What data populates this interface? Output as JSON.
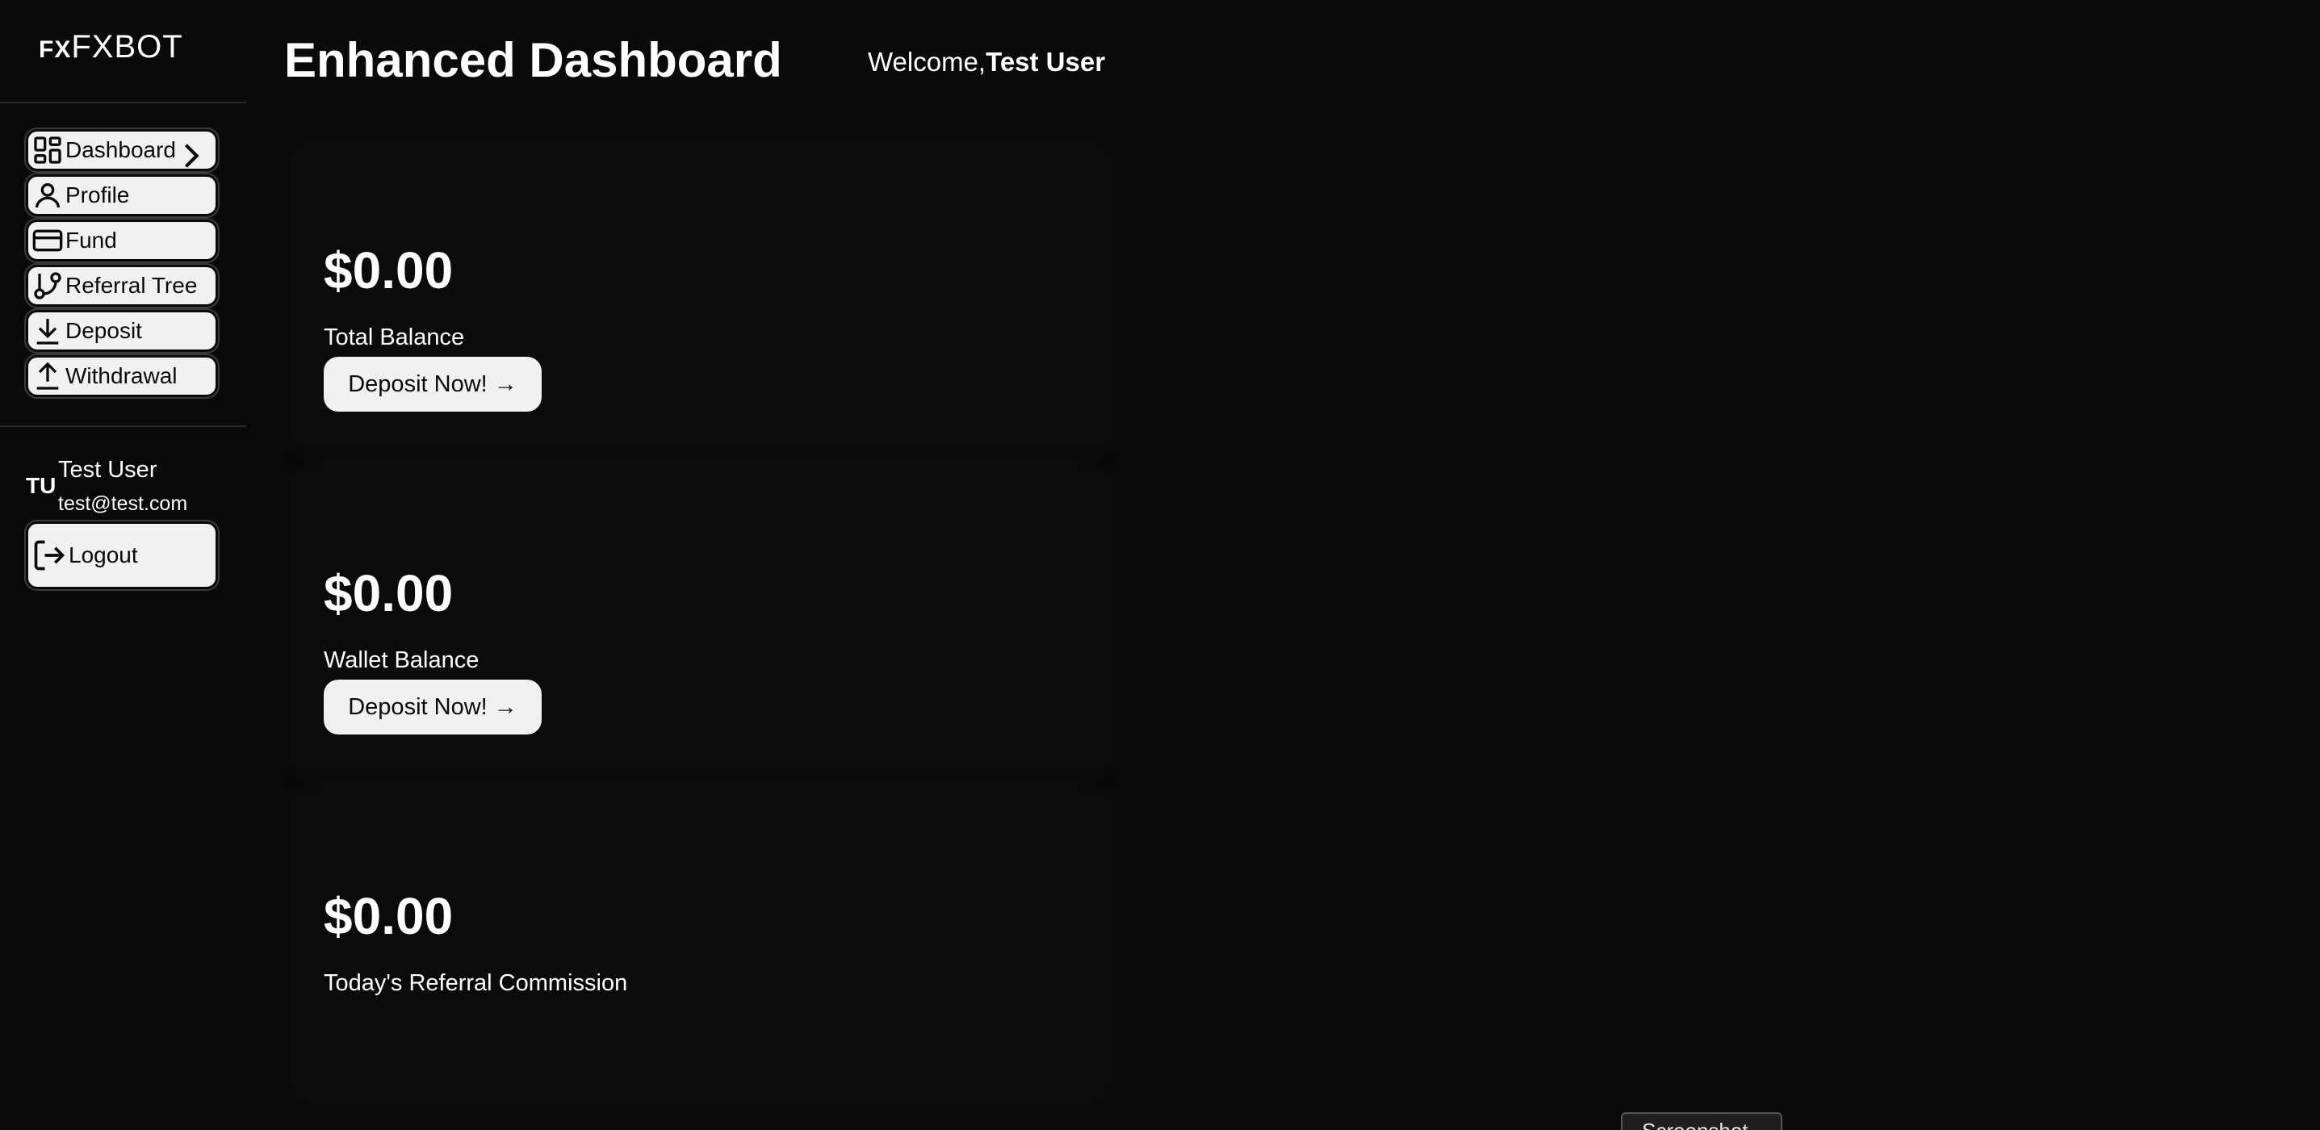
{
  "brand": {
    "mark": "FX",
    "name": "FXBOT"
  },
  "sidebar": {
    "items": [
      {
        "label": "Dashboard",
        "icon": "layout-grid-icon",
        "active": true
      },
      {
        "label": "Profile",
        "icon": "user-icon"
      },
      {
        "label": "Fund",
        "icon": "credit-card-icon"
      },
      {
        "label": "Referral Tree",
        "icon": "git-branch-icon"
      },
      {
        "label": "Deposit",
        "icon": "download-icon"
      },
      {
        "label": "Withdrawal",
        "icon": "upload-icon"
      }
    ],
    "user": {
      "initials": "TU",
      "name": "Test User",
      "email": "test@test.com"
    },
    "logout_label": "Logout"
  },
  "header": {
    "title": "Enhanced Dashboard",
    "welcome_prefix": "Welcome,",
    "welcome_name": "Test User"
  },
  "cards": [
    {
      "value": "$0.00",
      "label": "Total Balance",
      "button": "Deposit Now! →"
    },
    {
      "value": "$0.00",
      "label": "Wallet Balance",
      "button": "Deposit Now! →"
    },
    {
      "value": "$0.00",
      "label": "Today's Referral Commission"
    }
  ],
  "footer": {
    "screenshot_label": "Screenshot"
  },
  "colors": {
    "background": "#0a0a0a",
    "button_bg": "#f1f1f1",
    "text": "#ffffff"
  }
}
